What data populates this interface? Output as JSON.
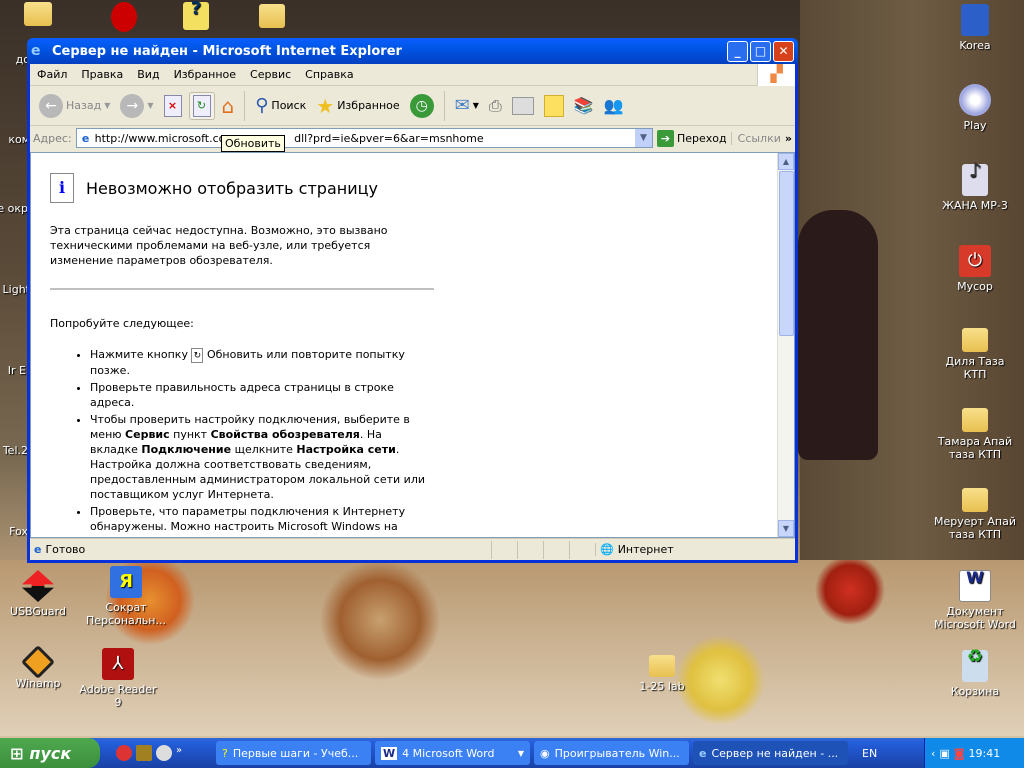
{
  "desktop": {
    "left_icons": [
      "до",
      "ком",
      "Се окр",
      "Light",
      "Ir E",
      "Tel.2",
      "Fox"
    ],
    "bottom_left_icons": [
      "USBGuard",
      "Сократ Персональн...",
      "Winamp",
      "Adobe Reader 9"
    ],
    "right_icons": [
      "Korea",
      "Play",
      "ЖАНА МР-3",
      "Мусор",
      "Диля Таза КТП",
      "Тамара Апай таза КТП",
      "Меруерт Апай таза КТП",
      "Документ Microsoft Word",
      "Корзина"
    ],
    "center_icon": "1-25 lab"
  },
  "window": {
    "title": "Сервер не найден - Microsoft Internet Explorer",
    "menu": [
      "Файл",
      "Правка",
      "Вид",
      "Избранное",
      "Сервис",
      "Справка"
    ],
    "toolbar": {
      "back": "Назад",
      "search": "Поиск",
      "favorites": "Избранное"
    },
    "address": {
      "label": "Адрес:",
      "url": "http://www.microsoft.com/isapi/redir.dll?prd=ie&pver=6&ar=msnhome",
      "visible_url_start": "http://www.microsoft.com",
      "visible_url_end": "dll?prd=ie&pver=6&ar=msnhome",
      "go": "Переход",
      "links": "Ссылки"
    },
    "tooltip": "Обновить",
    "page": {
      "heading": "Невозможно отобразить страницу",
      "intro": "Эта страница сейчас недоступна. Возможно, это вызвано техническими проблемами на веб-узле, или требуется изменение параметров обозревателя.",
      "try": "Попробуйте следующее:",
      "b1a": "Нажмите кнопку",
      "b1b": "Обновить или повторите попытку позже.",
      "b2": "Проверьте правильность адреса страницы в строке адреса.",
      "b3a": "Чтобы проверить настройку подключения, выберите в меню",
      "b3b": "Сервис",
      "b3c": "пункт",
      "b3d": "Свойства обозревателя",
      "b3e": ". На вкладке",
      "b3f": "Подключение",
      "b3g": "щелкните",
      "b3h": "Настройка сети",
      "b3i": ". Настройка должна соответствовать сведениям, предоставленным администратором локальной сети или поставщиком услуг Интернета.",
      "b4": "Проверьте, что параметры подключения к Интернету обнаружены. Можно настроить Microsoft Windows на"
    },
    "status": {
      "text": "Готово",
      "zone": "Интернет"
    }
  },
  "taskbar": {
    "start": "пуск",
    "tasks": [
      "Первые шаги - Учеб...",
      "4 Microsoft Word",
      "Проигрыватель Win...",
      "Сервер не найден - ..."
    ],
    "lang": "EN",
    "time": "19:41"
  }
}
